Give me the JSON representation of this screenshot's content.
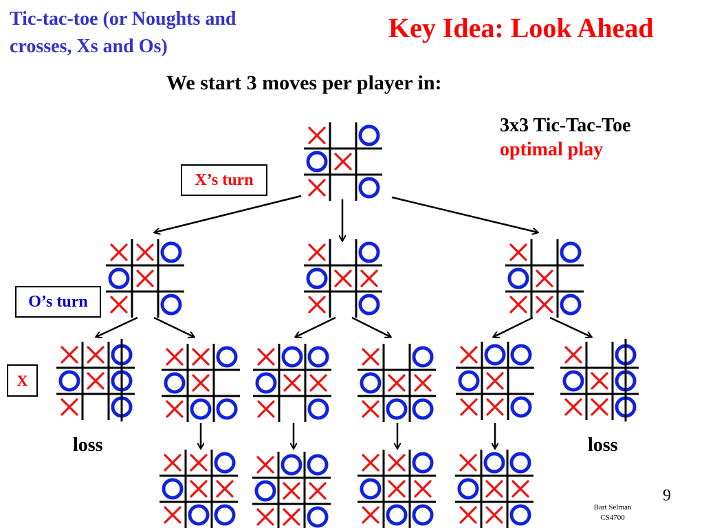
{
  "slide": {
    "title_left": "Tic-tac-toe (or Noughts and crosses, Xs and Os)",
    "title_right": "Key Idea: Look Ahead",
    "subtitle": "We start 3 moves per player in:",
    "side_heading": "3x3 Tic-Tac-Toe",
    "side_subheading": "optimal play",
    "labels": {
      "x_turn": "X’s turn",
      "o_turn": "O’s turn",
      "x_marker": "X",
      "loss_left": "loss",
      "loss_right": "loss"
    },
    "page_number": "9",
    "credit_line1": "Bart Selman",
    "credit_line2": "CS4700"
  },
  "colors": {
    "x_mark": "#ee1111",
    "o_mark": "#1122dd",
    "grid": "#000000",
    "title_blue": "#3333cc",
    "accent_red": "#ff0000"
  },
  "tree": {
    "root": {
      "id": "root",
      "cells": [
        "X",
        "",
        "O",
        "O",
        "X",
        "",
        "X",
        "",
        "O"
      ]
    },
    "level1": [
      {
        "id": "l1-left",
        "cells": [
          "X",
          "X",
          "O",
          "O",
          "X",
          "",
          "X",
          "",
          "O"
        ]
      },
      {
        "id": "l1-mid",
        "cells": [
          "X",
          "",
          "O",
          "O",
          "X",
          "X",
          "X",
          "",
          "O"
        ]
      },
      {
        "id": "l1-right",
        "cells": [
          "X",
          "",
          "O",
          "O",
          "X",
          "",
          "X",
          "X",
          "O"
        ]
      }
    ],
    "level2": [
      {
        "id": "l2-1",
        "parent": "l1-left",
        "cells": [
          "X",
          "X",
          "O",
          "O",
          "X",
          "O",
          "X",
          "",
          "O"
        ],
        "win_line": "col3",
        "result": "loss"
      },
      {
        "id": "l2-2",
        "parent": "l1-left",
        "cells": [
          "X",
          "X",
          "O",
          "O",
          "X",
          "",
          "X",
          "O",
          "O"
        ]
      },
      {
        "id": "l2-3",
        "parent": "l1-mid",
        "cells": [
          "X",
          "O",
          "O",
          "O",
          "X",
          "X",
          "X",
          "",
          "O"
        ]
      },
      {
        "id": "l2-4",
        "parent": "l1-mid",
        "cells": [
          "X",
          "",
          "O",
          "O",
          "X",
          "X",
          "X",
          "O",
          "O"
        ]
      },
      {
        "id": "l2-5",
        "parent": "l1-right",
        "cells": [
          "X",
          "O",
          "O",
          "O",
          "X",
          "",
          "X",
          "X",
          "O"
        ]
      },
      {
        "id": "l2-6",
        "parent": "l1-right",
        "cells": [
          "X",
          "",
          "O",
          "O",
          "X",
          "O",
          "X",
          "X",
          "O"
        ],
        "win_line": "col3",
        "result": "loss"
      }
    ],
    "level3": [
      {
        "id": "l3-1",
        "parent": "l2-2",
        "cells": [
          "X",
          "X",
          "O",
          "O",
          "X",
          "X",
          "X",
          "O",
          "O"
        ]
      },
      {
        "id": "l3-2",
        "parent": "l2-3",
        "cells": [
          "X",
          "O",
          "O",
          "O",
          "X",
          "X",
          "X",
          "X",
          "O"
        ]
      },
      {
        "id": "l3-3",
        "parent": "l2-4",
        "cells": [
          "X",
          "X",
          "O",
          "O",
          "X",
          "X",
          "X",
          "O",
          "O"
        ]
      },
      {
        "id": "l3-4",
        "parent": "l2-5",
        "cells": [
          "X",
          "O",
          "O",
          "O",
          "X",
          "X",
          "X",
          "X",
          "O"
        ]
      }
    ]
  }
}
